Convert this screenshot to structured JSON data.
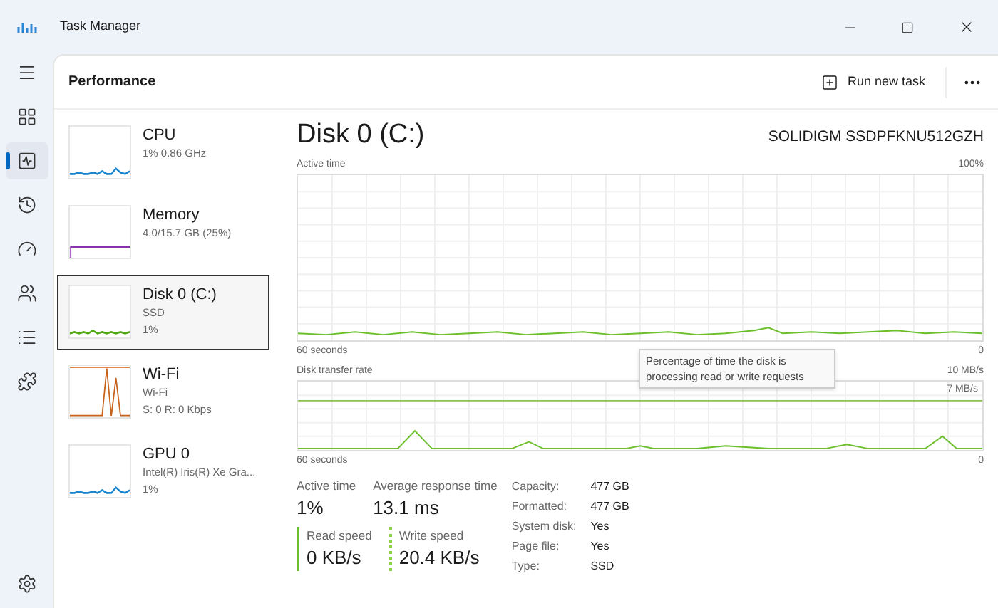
{
  "window": {
    "title": "Task Manager"
  },
  "nav": [
    {
      "kind": "menu",
      "selected": false
    },
    {
      "kind": "processes",
      "selected": false
    },
    {
      "kind": "performance",
      "selected": true
    },
    {
      "kind": "history",
      "selected": false
    },
    {
      "kind": "startup",
      "selected": false
    },
    {
      "kind": "users",
      "selected": false
    },
    {
      "kind": "details",
      "selected": false
    },
    {
      "kind": "services",
      "selected": false
    },
    {
      "kind": "settings",
      "selected": false
    }
  ],
  "header": {
    "title": "Performance",
    "action": "Run new task"
  },
  "devices": [
    {
      "name": "CPU",
      "lines": [
        "1% 0.86 GHz"
      ],
      "color": "#1a86d0",
      "selected": false
    },
    {
      "name": "Memory",
      "lines": [
        "4.0/15.7 GB (25%)"
      ],
      "color": "#8b2fb0",
      "selected": false
    },
    {
      "name": "Disk 0 (C:)",
      "lines": [
        "SSD",
        "1%"
      ],
      "color": "#4fa80f",
      "selected": true
    },
    {
      "name": "Wi-Fi",
      "lines": [
        "Wi-Fi",
        "S: 0 R: 0 Kbps"
      ],
      "color": "#c8621a",
      "selected": false
    },
    {
      "name": "GPU 0",
      "lines": [
        "Intel(R) Iris(R) Xe Gra...",
        "1%"
      ],
      "color": "#1a86d0",
      "selected": false
    }
  ],
  "detail": {
    "title": "Disk 0 (C:)",
    "model": "SOLIDIGM SSDPFKNU512GZH",
    "active_chart": {
      "label": "Active time",
      "max": "100%",
      "span": "60 seconds",
      "min": "0"
    },
    "transfer_chart": {
      "label": "Disk transfer rate",
      "max": "10 MB/s",
      "marker": "7 MB/s",
      "span": "60 seconds",
      "min": "0"
    },
    "tooltip": "Percentage of time the disk is processing read or write requests",
    "stats": [
      {
        "label": "Active time",
        "value": "1%"
      },
      {
        "label": "Average response time",
        "value": "13.1 ms"
      }
    ],
    "speeds": [
      {
        "label": "Read speed",
        "value": "0 KB/s",
        "kind": "read"
      },
      {
        "label": "Write speed",
        "value": "20.4 KB/s",
        "kind": "write"
      }
    ],
    "properties": [
      {
        "label": "Capacity:",
        "value": "477 GB"
      },
      {
        "label": "Formatted:",
        "value": "477 GB"
      },
      {
        "label": "System disk:",
        "value": "Yes"
      },
      {
        "label": "Page file:",
        "value": "Yes"
      },
      {
        "label": "Type:",
        "value": "SSD"
      }
    ]
  }
}
